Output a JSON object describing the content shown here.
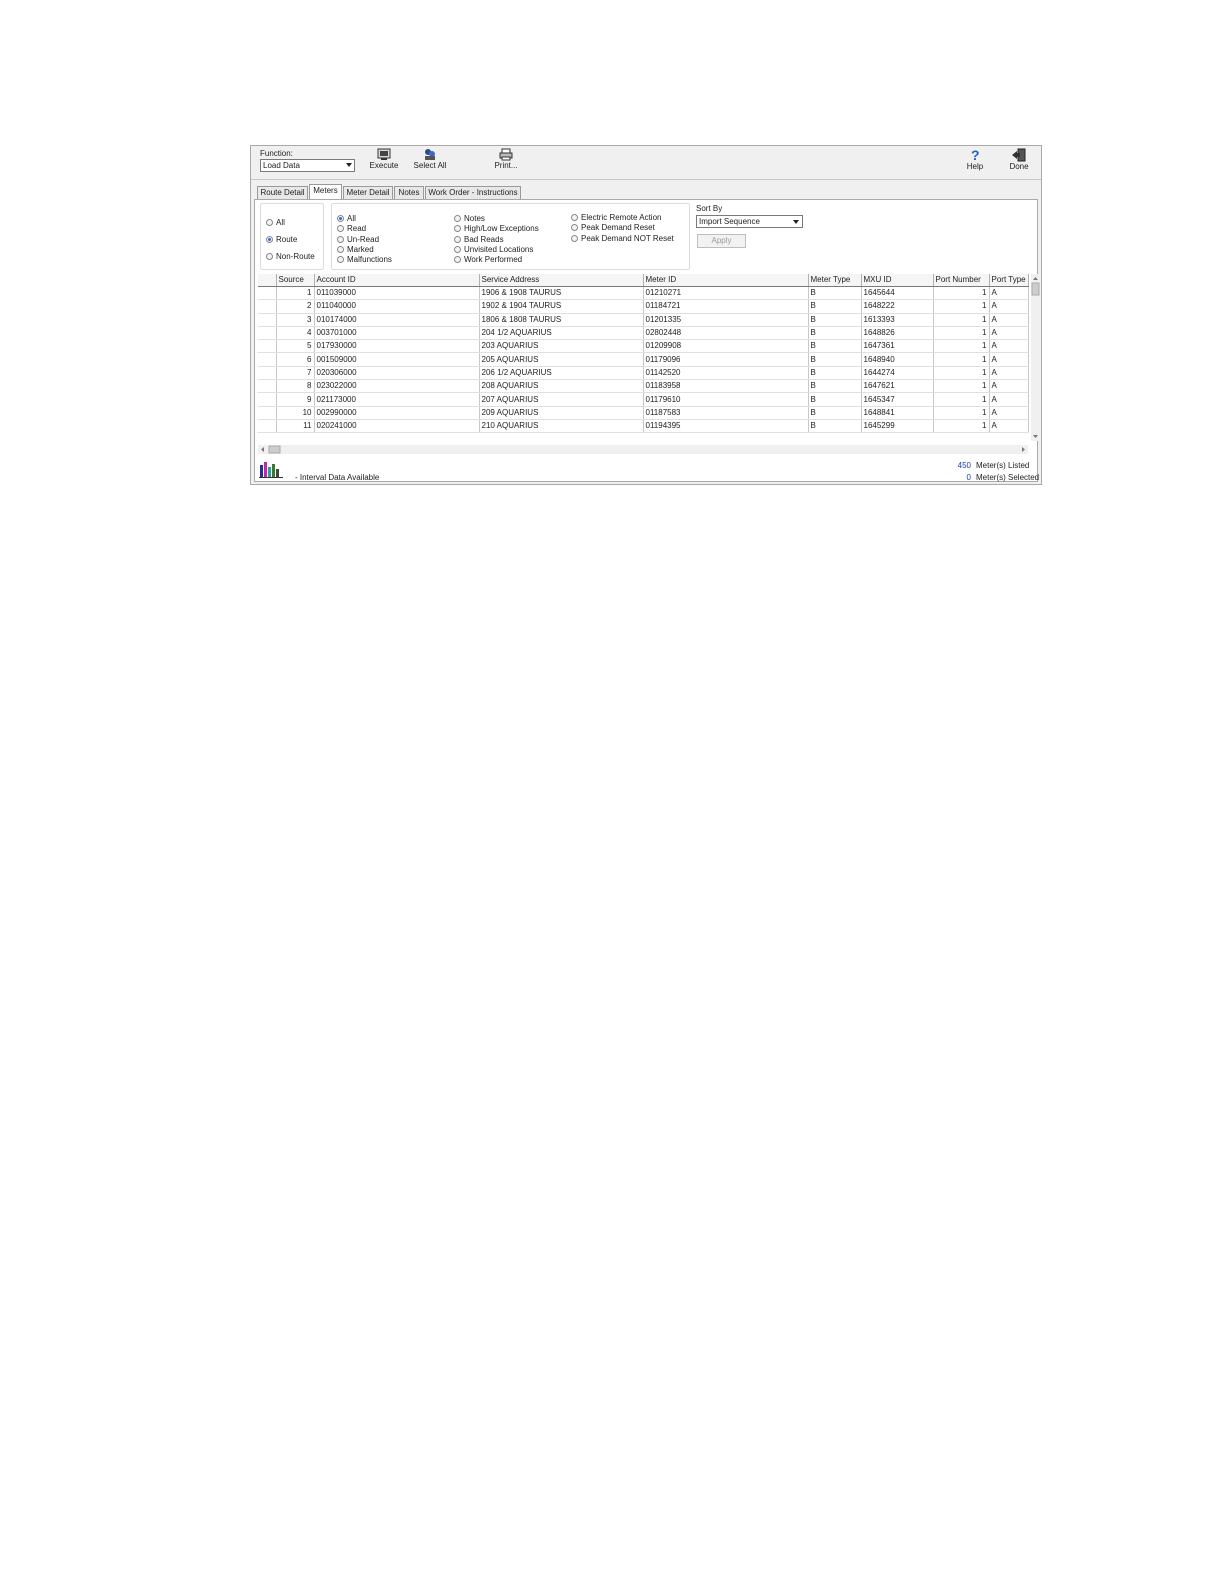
{
  "toolbar": {
    "function_label": "Function:",
    "function_value": "Load Data",
    "execute_label": "Execute",
    "select_all_label": "Select All",
    "print_label": "Print...",
    "help_label": "Help",
    "done_label": "Done"
  },
  "tabs": [
    "Route Detail",
    "Meters",
    "Meter Detail",
    "Notes",
    "Work Order - Instructions"
  ],
  "scope_filters": [
    {
      "label": "All",
      "selected": false
    },
    {
      "label": "Route",
      "selected": true
    },
    {
      "label": "Non-Route",
      "selected": false
    }
  ],
  "status_filters": {
    "col1": [
      {
        "label": "All",
        "selected": true
      },
      {
        "label": "Read",
        "selected": false
      },
      {
        "label": "Un-Read",
        "selected": false
      },
      {
        "label": "Marked",
        "selected": false
      },
      {
        "label": "Malfunctions",
        "selected": false
      }
    ],
    "col2": [
      {
        "label": "Notes",
        "selected": false
      },
      {
        "label": "High/Low Exceptions",
        "selected": false
      },
      {
        "label": "Bad Reads",
        "selected": false
      },
      {
        "label": "Unvisited Locations",
        "selected": false
      },
      {
        "label": "Work Performed",
        "selected": false
      }
    ],
    "col3": [
      {
        "label": "Electric Remote Action",
        "selected": false
      },
      {
        "label": "Peak Demand Reset",
        "selected": false
      },
      {
        "label": "Peak Demand NOT Reset",
        "selected": false
      }
    ]
  },
  "sort": {
    "label": "Sort By",
    "value": "Import Sequence",
    "apply_label": "Apply"
  },
  "table": {
    "columns": [
      "",
      "Source",
      "Account ID",
      "Service Address",
      "Meter ID",
      "Meter Type",
      "MXU ID",
      "Port Number",
      "Port Type"
    ],
    "rows": [
      [
        "",
        "1",
        "011039000",
        "1906 & 1908 TAURUS",
        "01210271",
        "B",
        "1645644",
        "1",
        "A"
      ],
      [
        "",
        "2",
        "011040000",
        "1902 & 1904 TAURUS",
        "01184721",
        "B",
        "1648222",
        "1",
        "A"
      ],
      [
        "",
        "3",
        "010174000",
        "1806 & 1808 TAURUS",
        "01201335",
        "B",
        "1613393",
        "1",
        "A"
      ],
      [
        "",
        "4",
        "003701000",
        "204 1/2 AQUARIUS",
        "02802448",
        "B",
        "1648826",
        "1",
        "A"
      ],
      [
        "",
        "5",
        "017930000",
        "203 AQUARIUS",
        "01209908",
        "B",
        "1647361",
        "1",
        "A"
      ],
      [
        "",
        "6",
        "001509000",
        "205 AQUARIUS",
        "01179096",
        "B",
        "1648940",
        "1",
        "A"
      ],
      [
        "",
        "7",
        "020306000",
        "206 1/2 AQUARIUS",
        "01142520",
        "B",
        "1644274",
        "1",
        "A"
      ],
      [
        "",
        "8",
        "023022000",
        "208 AQUARIUS",
        "01183958",
        "B",
        "1647621",
        "1",
        "A"
      ],
      [
        "",
        "9",
        "021173000",
        "207 AQUARIUS",
        "01179610",
        "B",
        "1645347",
        "1",
        "A"
      ],
      [
        "",
        "10",
        "002990000",
        "209 AQUARIUS",
        "01187583",
        "B",
        "1648841",
        "1",
        "A"
      ],
      [
        "",
        "11",
        "020241000",
        "210 AQUARIUS",
        "01194395",
        "B",
        "1645299",
        "1",
        "A"
      ]
    ]
  },
  "footer": {
    "legend_text": "- Interval Data Available",
    "listed_count": "450",
    "listed_label": "Meter(s) Listed",
    "selected_count": "0",
    "selected_label": "Meter(s) Selected"
  },
  "colors": {
    "accent_blue": "#2a6fd6",
    "count_blue": "#1a3fb0"
  }
}
